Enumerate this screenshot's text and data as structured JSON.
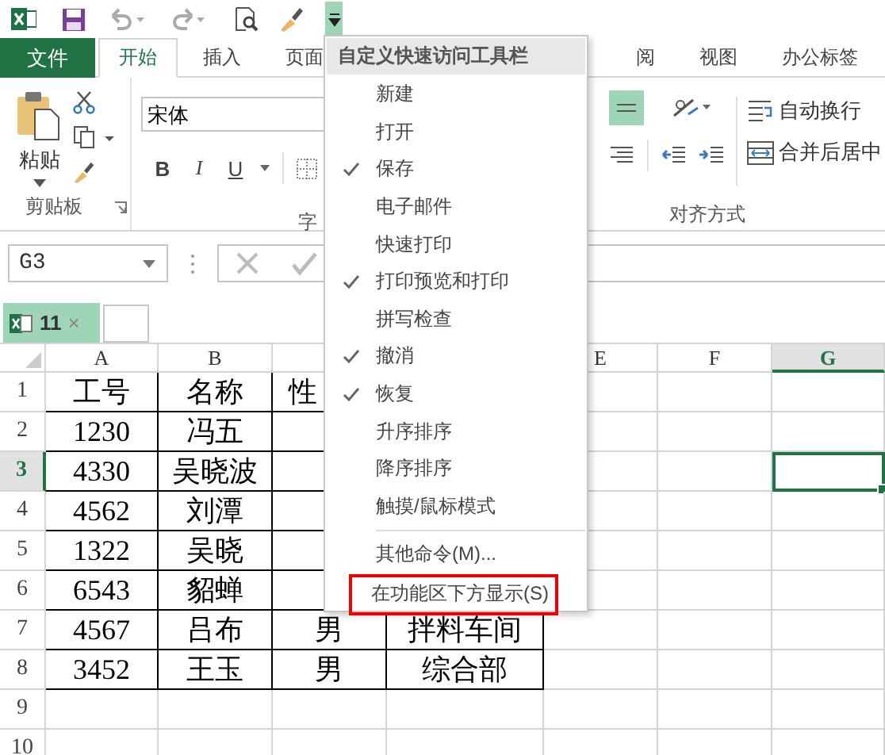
{
  "ribbon_tabs": [
    {
      "label": "文件",
      "kind": "file",
      "selected": false
    },
    {
      "label": "开始",
      "kind": "tab",
      "selected": true
    },
    {
      "label": "插入",
      "kind": "tab",
      "selected": false
    },
    {
      "label": "页面",
      "kind": "tab",
      "selected": false
    },
    {
      "label": "阅",
      "kind": "tab",
      "selected": false
    },
    {
      "label": "视图",
      "kind": "tab",
      "selected": false
    },
    {
      "label": "办公标签",
      "kind": "tab",
      "selected": false
    }
  ],
  "clipboard": {
    "paste_label": "粘贴",
    "group_label": "剪贴板"
  },
  "font": {
    "font_name": "宋体",
    "bold": "B",
    "italic": "I",
    "underline": "U",
    "group_label": "字"
  },
  "alignment": {
    "middle_align": {
      "on": true
    },
    "wrap_text": "自动换行",
    "merge_center": "合并后居中",
    "group_label": "对齐方式"
  },
  "formula_bar": {
    "name_box": "G3"
  },
  "sheet_tab": {
    "label": "11",
    "close": "×",
    "selected": true
  },
  "columns": [
    {
      "label": "A",
      "selected": false
    },
    {
      "label": "B",
      "selected": false
    },
    {},
    {},
    {
      "label": "E",
      "selected": false
    },
    {
      "label": "F",
      "selected": false
    },
    {
      "label": "G",
      "selected": true
    }
  ],
  "rows": [
    {
      "label": "1",
      "selected": false,
      "cells": [
        "工号",
        "名称",
        "性"
      ]
    },
    {
      "label": "2",
      "selected": false,
      "cells": [
        "1230",
        "冯五"
      ]
    },
    {
      "label": "3",
      "selected": true,
      "cells": [
        "4330",
        "吴晓波"
      ]
    },
    {
      "label": "4",
      "selected": false,
      "cells": [
        "4562",
        "刘潭"
      ]
    },
    {
      "label": "5",
      "selected": false,
      "cells": [
        "1322",
        "吴晓"
      ]
    },
    {
      "label": "6",
      "selected": false,
      "cells": [
        "6543",
        "貂蝉"
      ]
    },
    {
      "label": "7",
      "selected": false,
      "cells": [
        "4567",
        "吕布",
        "男",
        "拌料车间"
      ]
    },
    {
      "label": "8",
      "selected": false,
      "cells": [
        "3452",
        "王玉",
        "男",
        "综合部"
      ]
    },
    {
      "label": "9",
      "selected": false,
      "cells": []
    },
    {
      "label": "10",
      "selected": false,
      "cells": []
    }
  ],
  "menu": {
    "title": "自定义快速访问工具栏",
    "items": [
      {
        "label": "新建",
        "kind": "toggle",
        "checked": false
      },
      {
        "label": "打开",
        "kind": "toggle",
        "checked": false
      },
      {
        "label": "保存",
        "kind": "toggle",
        "checked": true
      },
      {
        "label": "电子邮件",
        "kind": "toggle",
        "checked": false
      },
      {
        "label": "快速打印",
        "kind": "toggle",
        "checked": false
      },
      {
        "label": "打印预览和打印",
        "kind": "toggle",
        "checked": true
      },
      {
        "label": "拼写检查",
        "kind": "toggle",
        "checked": false
      },
      {
        "label": "撤消",
        "kind": "toggle",
        "checked": true
      },
      {
        "label": "恢复",
        "kind": "toggle",
        "checked": true
      },
      {
        "label": "升序排序",
        "kind": "toggle",
        "checked": false
      },
      {
        "label": "降序排序",
        "kind": "toggle",
        "checked": false
      },
      {
        "label": "触摸/鼠标模式",
        "kind": "toggle",
        "checked": false
      },
      {
        "kind": "separator"
      },
      {
        "label": "其他命令(M)...",
        "kind": "command",
        "highlighted": false
      },
      {
        "label": "在功能区下方显示(S)",
        "kind": "command",
        "highlighted": true
      }
    ]
  }
}
